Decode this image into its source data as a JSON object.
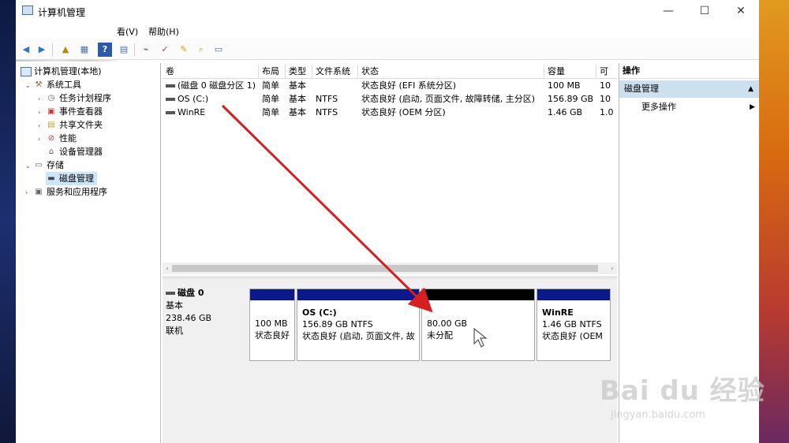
{
  "window": {
    "title": "计算机管理",
    "controls": {
      "minimize": "—",
      "maximize": "☐",
      "close": "✕"
    }
  },
  "menu": {
    "items": [
      {
        "label": "看(V)"
      },
      {
        "label": "帮助(H)"
      }
    ]
  },
  "tree": {
    "items": [
      {
        "label": "计算机管理(本地)",
        "icon": "computer-icon"
      },
      {
        "label": "系统工具",
        "icon": "tools-icon"
      },
      {
        "label": "任务计划程序",
        "icon": "clock-icon"
      },
      {
        "label": "事件查看器",
        "icon": "event-icon"
      },
      {
        "label": "共享文件夹",
        "icon": "folder-icon"
      },
      {
        "label": "性能",
        "icon": "performance-icon"
      },
      {
        "label": "设备管理器",
        "icon": "device-icon"
      },
      {
        "label": "存储",
        "icon": "storage-icon"
      },
      {
        "label": "磁盘管理",
        "icon": "disk-icon"
      },
      {
        "label": "服务和应用程序",
        "icon": "services-icon"
      }
    ]
  },
  "volume_table": {
    "headers": [
      "卷",
      "布局",
      "类型",
      "文件系统",
      "状态",
      "容量",
      "可"
    ],
    "rows": [
      {
        "volume": "(磁盘 0 磁盘分区 1)",
        "layout": "简单",
        "type": "基本",
        "fs": "",
        "status": "状态良好 (EFI 系统分区)",
        "capacity": "100 MB",
        "avail": "10"
      },
      {
        "volume": "OS (C:)",
        "layout": "简单",
        "type": "基本",
        "fs": "NTFS",
        "status": "状态良好 (启动, 页面文件, 故障转储, 主分区)",
        "capacity": "156.89 GB",
        "avail": "10"
      },
      {
        "volume": "WinRE",
        "layout": "简单",
        "type": "基本",
        "fs": "NTFS",
        "status": "状态良好 (OEM 分区)",
        "capacity": "1.46 GB",
        "avail": "1.0"
      }
    ]
  },
  "disk": {
    "name": "磁盘 0",
    "type": "基本",
    "size": "238.46 GB",
    "state": "联机",
    "partitions": [
      {
        "title": "",
        "line1": "100 MB",
        "line2": "状态良好",
        "bar_color": "#0a1a8a"
      },
      {
        "title": "OS  (C:)",
        "line1": "156.89 GB NTFS",
        "line2": "状态良好 (启动, 页面文件, 故",
        "bar_color": "#0a1a8a"
      },
      {
        "title": "",
        "line1": "80.00 GB",
        "line2": "未分配",
        "bar_color": "#000000"
      },
      {
        "title": "WinRE",
        "line1": "1.46 GB NTFS",
        "line2": "状态良好 (OEM",
        "bar_color": "#0a1a8a"
      }
    ]
  },
  "actions": {
    "header": "操作",
    "section": "磁盘管理",
    "item": "更多操作"
  },
  "watermark": {
    "main": "Bai du 经验",
    "sub": "jingyan.baidu.com"
  },
  "colors": {
    "arrow": "#d42020",
    "selection": "#cde6f7",
    "partition_bar": "#0a1a8a",
    "unallocated_bar": "#000000"
  }
}
